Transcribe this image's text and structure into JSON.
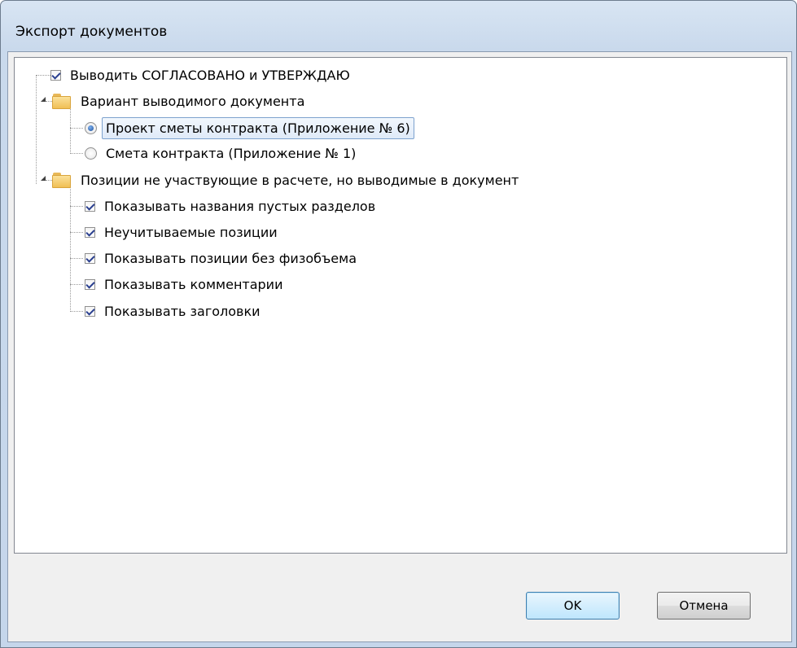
{
  "window": {
    "title": "Экспорт документов"
  },
  "tree": {
    "item_approve": {
      "label": "Выводить СОГЛАСОВАНО и УТВЕРЖДАЮ",
      "checked": true
    },
    "group_variant": {
      "label": "Вариант выводимого документа",
      "options": [
        {
          "label": "Проект сметы контракта (Приложение № 6)",
          "selected": true
        },
        {
          "label": "Смета контракта (Приложение № 1)",
          "selected": false
        }
      ]
    },
    "group_positions": {
      "label": "Позиции не участвующие в расчете, но выводимые в документ",
      "items": [
        {
          "label": "Показывать названия пустых разделов",
          "checked": true
        },
        {
          "label": "Неучитываемые позиции",
          "checked": true
        },
        {
          "label": "Показывать позиции без физобъема",
          "checked": true
        },
        {
          "label": "Показывать комментарии",
          "checked": true
        },
        {
          "label": "Показывать заголовки",
          "checked": true
        }
      ]
    }
  },
  "buttons": {
    "ok": "OK",
    "cancel": "Отмена"
  }
}
